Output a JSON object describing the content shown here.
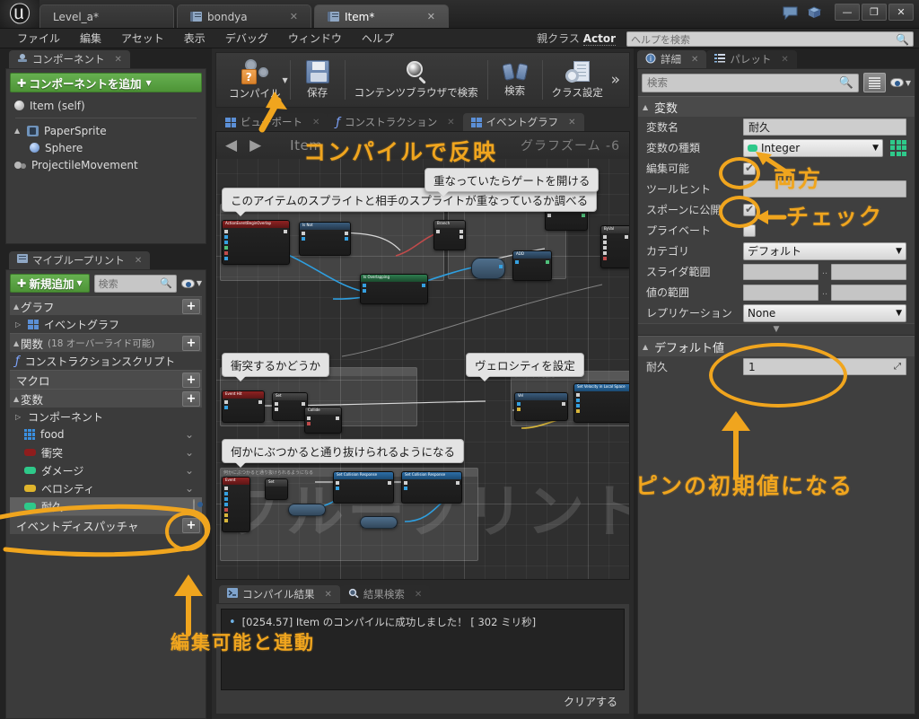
{
  "window": {
    "tabs": [
      {
        "label": "Level_a*",
        "icon": "level-icon",
        "active": false,
        "closable": false
      },
      {
        "label": "bondya",
        "icon": "blueprint-icon",
        "active": false,
        "closable": true
      },
      {
        "label": "Item*",
        "icon": "blueprint-icon",
        "active": true,
        "closable": true
      }
    ],
    "controls": {
      "minimize": "—",
      "maximize": "❐",
      "close": "✕"
    },
    "logo": "unreal-logo"
  },
  "menubar": {
    "items": [
      "ファイル",
      "編集",
      "アセット",
      "表示",
      "デバッグ",
      "ウィンドウ",
      "ヘルプ"
    ],
    "parent_class_label": "親クラス",
    "parent_class_value": "Actor",
    "help_search_placeholder": "ヘルプを検索"
  },
  "components_panel": {
    "tab_label": "コンポーネント",
    "add_button": "コンポーネントを追加",
    "tree": [
      {
        "label": "Item (self)",
        "icon": "self-sphere-icon",
        "indent": 0
      },
      {
        "label": "PaperSprite",
        "icon": "paper-sprite-icon",
        "indent": 0,
        "expander": "▲"
      },
      {
        "label": "Sphere",
        "icon": "sphere-icon",
        "indent": 1
      },
      {
        "label": "ProjectileMovement",
        "icon": "projectile-movement-icon",
        "indent": 0
      }
    ]
  },
  "myblueprint_panel": {
    "tab_label": "マイブループリント",
    "add_button": "新規追加",
    "search_placeholder": "検索",
    "sections": [
      {
        "title": "グラフ",
        "sub": "",
        "plus": "+"
      },
      {
        "title": "関数",
        "sub": "(18 オーバーライド可能)",
        "plus": "+"
      },
      {
        "title": "マクロ",
        "sub": "",
        "plus": "+"
      },
      {
        "title": "変数",
        "sub": "",
        "plus": "+"
      },
      {
        "title": "イベントディスパッチャ",
        "sub": "",
        "plus": "+"
      }
    ],
    "graph_items": [
      {
        "label": "イベントグラフ",
        "icon": "event-graph-icon"
      }
    ],
    "function_items": [
      {
        "label": "コンストラクションスクリプト",
        "icon": "function-icon"
      }
    ],
    "variables_group": "コンポーネント",
    "variables": [
      {
        "label": "food",
        "icon": "array-grid-icon",
        "color": "#3a8fe0",
        "selected": false
      },
      {
        "label": "衝突",
        "icon": "bool-pill-icon",
        "color": "#8f1d1d",
        "selected": false
      },
      {
        "label": "ダメージ",
        "icon": "int-pill-icon",
        "color": "#2ec98a",
        "selected": false
      },
      {
        "label": "ベロシティ",
        "icon": "vector-pill-icon",
        "color": "#e0b52c",
        "selected": false
      },
      {
        "label": "耐久",
        "icon": "int-pill-icon",
        "color": "#2ec98a",
        "selected": true
      }
    ]
  },
  "toolbar": {
    "items": [
      {
        "label": "コンパイル",
        "icon": "compile-icon",
        "has_dropdown": true
      },
      {
        "label": "保存",
        "icon": "save-icon",
        "has_dropdown": false
      },
      {
        "label": "コンテンツブラウザで検索",
        "icon": "magnifier-icon",
        "has_dropdown": false
      },
      {
        "label": "検索",
        "icon": "binoculars-icon",
        "has_dropdown": false
      },
      {
        "label": "クラス設定",
        "icon": "class-settings-icon",
        "has_dropdown": false
      }
    ],
    "overflow": "»"
  },
  "graph_tabs": [
    {
      "label": "ビューポート",
      "icon": "viewport-icon",
      "active": false
    },
    {
      "label": "コンストラクション",
      "icon": "function-icon",
      "active": false
    },
    {
      "label": "イベントグラフ",
      "icon": "event-graph-icon",
      "active": true
    }
  ],
  "graph": {
    "name": "Item",
    "zoom_label": "グラフズーム",
    "zoom_value": "-6",
    "watermark": "ブループリント",
    "back_arrow": "◀",
    "forward_arrow": "▶",
    "tooltips": [
      "このアイテムのスプライトと相手のスプライトが重なっているか調べる",
      "重なっていたらゲートを開ける",
      "衝突するかどうか",
      "ヴェロシティを設定",
      "何かにぶつかると通り抜けられるようになる"
    ],
    "comment_boxes": [
      "このアイテムのスプライトと相手のスプライトが重なっているか調べる",
      "重なっていたらゲートを開ける",
      "衝突するかどうか",
      "ヴェロシティを設定",
      "何かにぶつかると通り抜けられるようになる"
    ]
  },
  "results_panel": {
    "tabs": [
      {
        "label": "コンパイル結果",
        "icon": "compile-results-icon",
        "active": true
      },
      {
        "label": "結果検索",
        "icon": "search-results-icon",
        "active": false
      }
    ],
    "log_entries": [
      {
        "bullet": "•",
        "text": "[0254.57] Item のコンパイルに成功しました！ [ 302 ミリ秒]"
      }
    ],
    "clear_button": "クリアする"
  },
  "details_panel": {
    "tabs": [
      {
        "label": "詳細",
        "icon": "details-icon",
        "active": true
      },
      {
        "label": "パレット",
        "icon": "palette-icon",
        "active": false
      }
    ],
    "search_placeholder": "検索",
    "category_variable": "変数",
    "category_default": "デフォルト値",
    "rows": [
      {
        "label": "変数名",
        "type": "text",
        "value": "耐久"
      },
      {
        "label": "変数の種類",
        "type": "combo",
        "value": "Integer",
        "swatch": "#2ec98a",
        "has_grid": true
      },
      {
        "label": "編集可能",
        "type": "checkbox",
        "checked": true
      },
      {
        "label": "ツールヒント",
        "type": "text",
        "value": ""
      },
      {
        "label": "スポーンに公開",
        "type": "checkbox",
        "checked": true
      },
      {
        "label": "プライベート",
        "type": "checkbox",
        "checked": false
      },
      {
        "label": "カテゴリ",
        "type": "combo",
        "value": "デフォルト"
      },
      {
        "label": "スライダ範囲",
        "type": "range",
        "min": "",
        "max": "",
        "sep": ".."
      },
      {
        "label": "値の範囲",
        "type": "range",
        "min": "",
        "max": "",
        "sep": ".."
      },
      {
        "label": "レプリケーション",
        "type": "combo",
        "value": "None"
      }
    ],
    "default_rows": [
      {
        "label": "耐久",
        "type": "spinner",
        "value": "1"
      }
    ]
  },
  "annotations": [
    {
      "id": "compile-reflect",
      "text": "コンパイルで反映"
    },
    {
      "id": "both-check",
      "text": "両方"
    },
    {
      "id": "check-word",
      "text": "チェック"
    },
    {
      "id": "pin-default",
      "text": "ピンの初期値になる"
    },
    {
      "id": "editable-link",
      "text": "編集可能と連動"
    }
  ],
  "colors": {
    "accent": "#f0a51e",
    "green_button": "#4e9437",
    "integer_type": "#2ec98a",
    "bool_type": "#8f1d1d",
    "vector_type": "#e0b52c",
    "array_type": "#3a8fe0"
  }
}
